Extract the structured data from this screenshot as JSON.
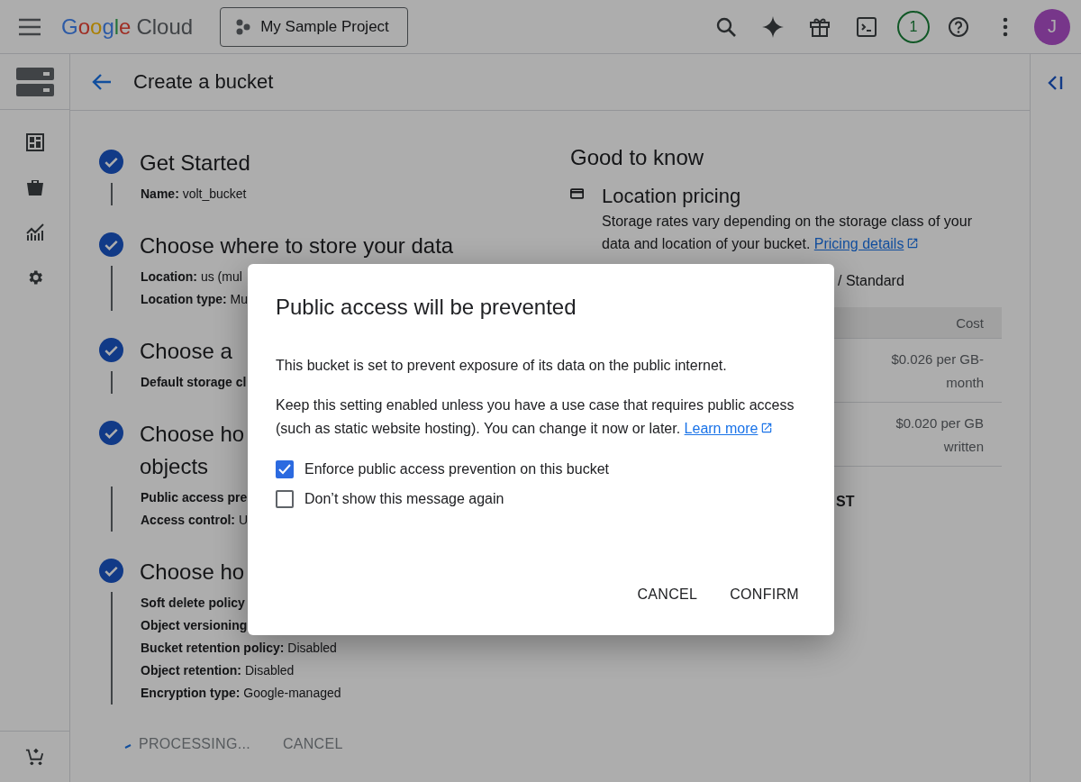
{
  "header": {
    "brand_google": "Google",
    "brand_cloud": "Cloud",
    "project": "My Sample Project",
    "notifications": "1",
    "avatar": "J"
  },
  "page_title": "Create a bucket",
  "steps": [
    {
      "title": [
        "Get Started"
      ],
      "details": [
        "**Name:** volt_bucket"
      ]
    },
    {
      "title": [
        "Choose where to store your data"
      ],
      "details": [
        "**Location:** us (mul",
        "**Location type:** Mu"
      ]
    },
    {
      "title": [
        "Choose a"
      ],
      "details": [
        "**Default storage cl**"
      ]
    },
    {
      "title": [
        "Choose ho",
        "objects"
      ],
      "details": [
        "**Public access pre**",
        "**Access control:** U"
      ]
    },
    {
      "title": [
        "Choose ho"
      ],
      "details": [
        "**Soft delete policy**",
        "**Object versioning**",
        "**Bucket retention policy:** Disabled",
        "**Object retention:** Disabled",
        "**Encryption type:** Google-managed"
      ]
    }
  ],
  "actions": {
    "processing": "PROCESSING...",
    "cancel": "CANCEL"
  },
  "info": {
    "title": "Good to know",
    "section_title": "Location pricing",
    "description": "Storage rates vary depending on the storage class of your data and location of your bucket.",
    "link": "Pricing details",
    "summary": "/ Standard",
    "table": {
      "columns": [
        "Cost"
      ],
      "rows": [
        {
          "cost": "$0.026 per GB-month"
        },
        {
          "cost": "$0.020 per GB written"
        }
      ]
    },
    "footer": "ST"
  },
  "dialog": {
    "title": "Public access will be prevented",
    "paragraphs": [
      {
        "text": "This bucket is set to prevent exposure of its data on the public internet."
      },
      {
        "text": "Keep this setting enabled unless you have a use case that requires public access (such as static website hosting). You can change it now or later.",
        "link": "Learn more"
      }
    ],
    "checkboxes": [
      {
        "label": "Enforce public access prevention on this bucket",
        "checked": true
      },
      {
        "label": "Don’t show this message again",
        "checked": false
      }
    ],
    "buttons": [
      {
        "label": "CANCEL"
      },
      {
        "label": "CONFIRM"
      }
    ]
  }
}
